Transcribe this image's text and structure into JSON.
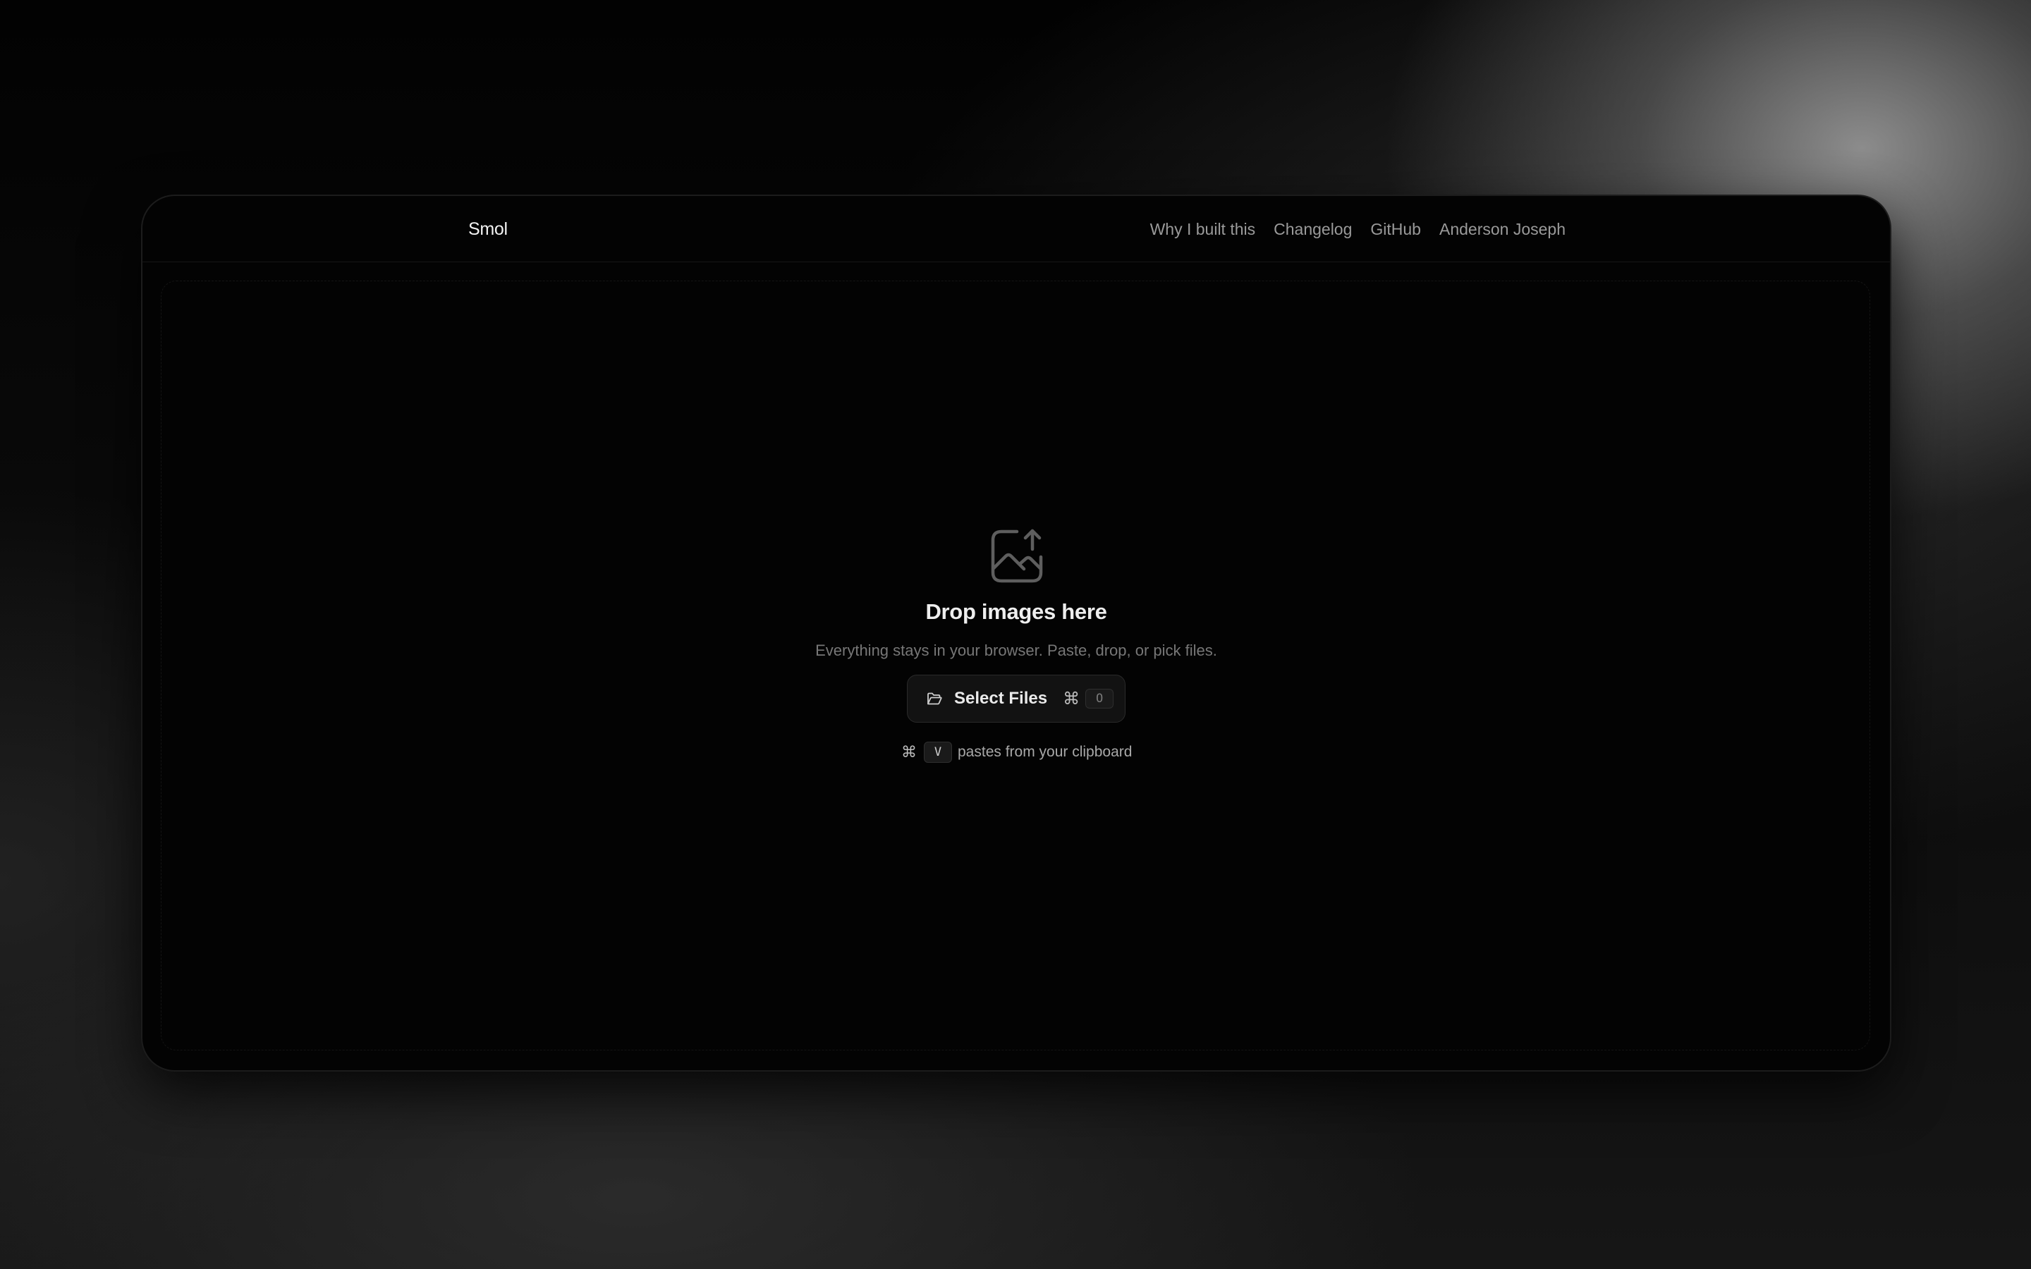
{
  "header": {
    "logo": "Smol",
    "nav": [
      {
        "label": "Why I built this"
      },
      {
        "label": "Changelog"
      },
      {
        "label": "GitHub"
      },
      {
        "label": "Anderson Joseph"
      }
    ]
  },
  "dropzone": {
    "icon": "image-upload-icon",
    "title": "Drop images here",
    "subtitle": "Everything stays in your browser. Paste, drop, or pick files.",
    "select_button": {
      "icon": "folder-open-icon",
      "label": "Select Files",
      "shortcut_modifier": "⌘",
      "shortcut_key": "O"
    },
    "paste_hint": {
      "modifier": "⌘",
      "key": "V",
      "text": "pastes from your clipboard"
    }
  },
  "colors": {
    "background": "#030303",
    "text_primary": "#eeeeee",
    "text_muted": "#777777",
    "nav_text": "#9a9a9a"
  }
}
